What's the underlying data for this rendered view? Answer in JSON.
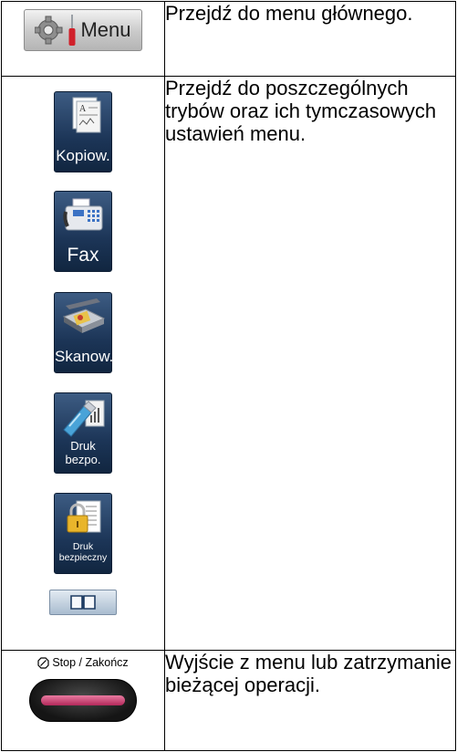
{
  "rows": [
    {
      "buttons": {
        "menu_label": "Menu"
      },
      "description": "Przejdź do menu głównego."
    },
    {
      "tiles": {
        "copy": "Kopiow.",
        "fax": "Fax",
        "scan": "Skanow.",
        "usb_line1": "Druk",
        "usb_line2": "bezpo.",
        "secure_line1": "Druk",
        "secure_line2": "bezpieczny"
      },
      "description": "Przejdź do poszczególnych trybów oraz ich tymczasowych ustawień menu."
    },
    {
      "buttons": {
        "stop_label": "Stop / Zakończ"
      },
      "description": "Wyjście z menu lub zatrzymanie bieżącej operacji."
    }
  ],
  "colors": {
    "tile": "#1c3557",
    "stop_bar": "#c8336a",
    "text": "#000000"
  },
  "icons": [
    "gear-icon",
    "screwdriver-icon",
    "copy-icon",
    "fax-icon",
    "scanner-icon",
    "usb-icon",
    "lock-icon",
    "book-icon",
    "stop-icon"
  ]
}
